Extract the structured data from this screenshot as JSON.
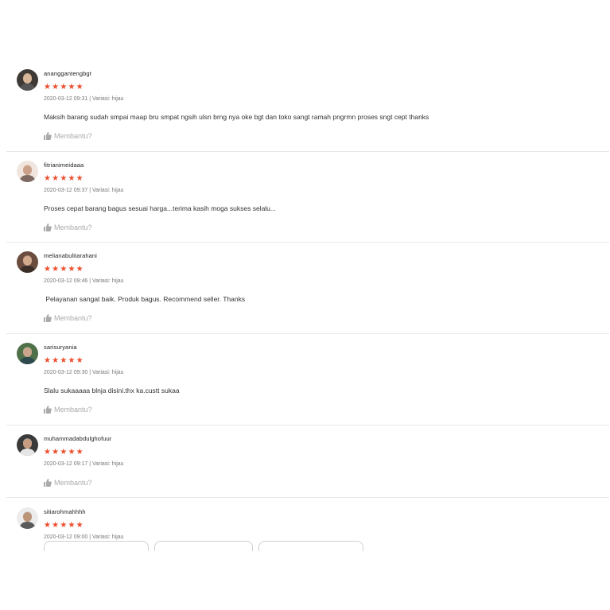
{
  "reviews": [
    {
      "username": "ananggantengbgt",
      "rating": 5,
      "meta": "2020-03-12 09:31 | Variasi: hijau",
      "comment": "Maksih barang sudah smpai maap bru smpat ngsih ulsn brng nya oke bgt dan toko sangt ramah pngrmn proses sngt cept thanks",
      "helpful_label": "Membantu?"
    },
    {
      "username": "fitrianimeidaaa",
      "rating": 5,
      "meta": "2020-03-12 09:37 | Variasi: hijau",
      "comment": "Proses cepat barang bagus sesuai harga...terima kasih moga sukses selalu...",
      "helpful_label": "Membantu?"
    },
    {
      "username": "melianabulitarahani",
      "rating": 5,
      "meta": "2020-03-12 09:46 | Variasi: hijau",
      "comment": " Pelayanan sangat baik. Produk bagus. Recommend seller. Thanks",
      "helpful_label": "Membantu?"
    },
    {
      "username": "sarisuryania",
      "rating": 5,
      "meta": "2020-03-12 09:30 | Variasi: hijau",
      "comment": "Slalu sukaaaaa blnja disini.thx ka.custt sukaa",
      "helpful_label": "Membantu?"
    },
    {
      "username": "muhammadabdulghofuur",
      "rating": 5,
      "meta": "2020-03-12 09:17 | Variasi: hijau",
      "comment": "",
      "helpful_label": "Membantu?"
    },
    {
      "username": "sitiarohmahhhh",
      "rating": 5,
      "meta": "2020-03-12 09:00 | Variasi: hijau",
      "comment": "",
      "helpful_label": ""
    }
  ],
  "colors": {
    "star": "#ee4d2d",
    "muted_text": "#aaaaaa",
    "divider": "#e8e8e8"
  },
  "icons": {
    "star": "star-icon",
    "helpful": "thumbs-up-icon"
  }
}
